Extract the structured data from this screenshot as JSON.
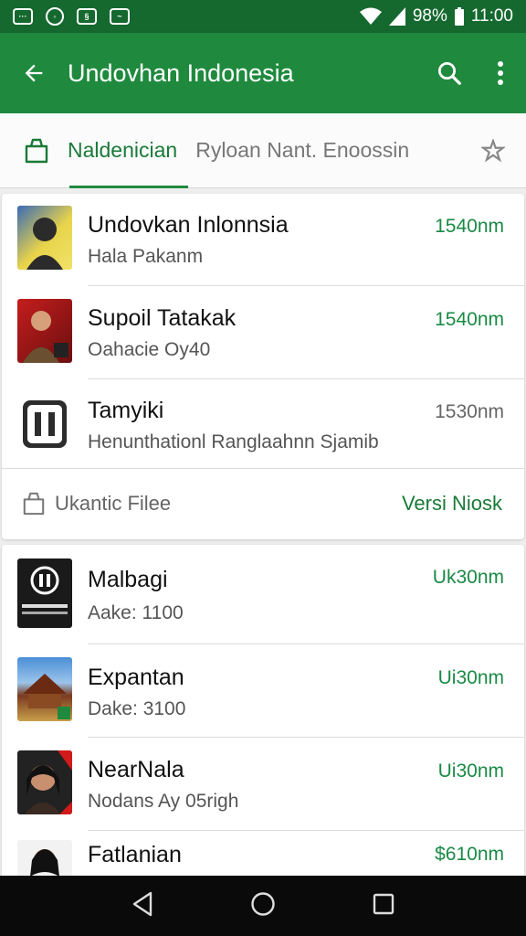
{
  "status_bar": {
    "battery": "98%",
    "time": "11:00",
    "notif_icons": [
      "message-icon",
      "chat-icon",
      "app-icon",
      "image-icon"
    ]
  },
  "app_bar": {
    "title": "Undovhan Indonesia",
    "back_icon": "arrow-back-icon",
    "search_icon": "search-icon",
    "menu_icon": "more-vert-icon",
    "color": "#1f8a3e"
  },
  "tabs": {
    "active": "Naldenician",
    "other": "Ryloan Nant. Enoossin",
    "star_icon": "star-icon"
  },
  "card1": {
    "items": [
      {
        "title": "Undovkan Inlonnsia",
        "subtitle": "Hala Pakanm",
        "price": "1540nm"
      },
      {
        "title": "Supoil Tatakak",
        "subtitle": "Oahacie Oy40",
        "price": "1540nm"
      },
      {
        "title": "Tamyiki",
        "subtitle": "Henunthationl Ranglaahnn Sjamib",
        "price": "1530nm"
      }
    ],
    "footer_label": "Ukantic Filee",
    "footer_link": "Versi Niosk"
  },
  "card2": {
    "items": [
      {
        "title": "Malbagi",
        "subtitle": "Aake: 1100",
        "price": "Uk30nm"
      },
      {
        "title": "Expantan",
        "subtitle": "Dake: 3100",
        "price": "Ui30nm"
      },
      {
        "title": "NearNala",
        "subtitle": "Nodans Ay 05righ",
        "price": "Ui30nm"
      },
      {
        "title": "Fatlanian",
        "subtitle": "",
        "price": "$610nm"
      }
    ]
  },
  "accent": "#1a8a45"
}
